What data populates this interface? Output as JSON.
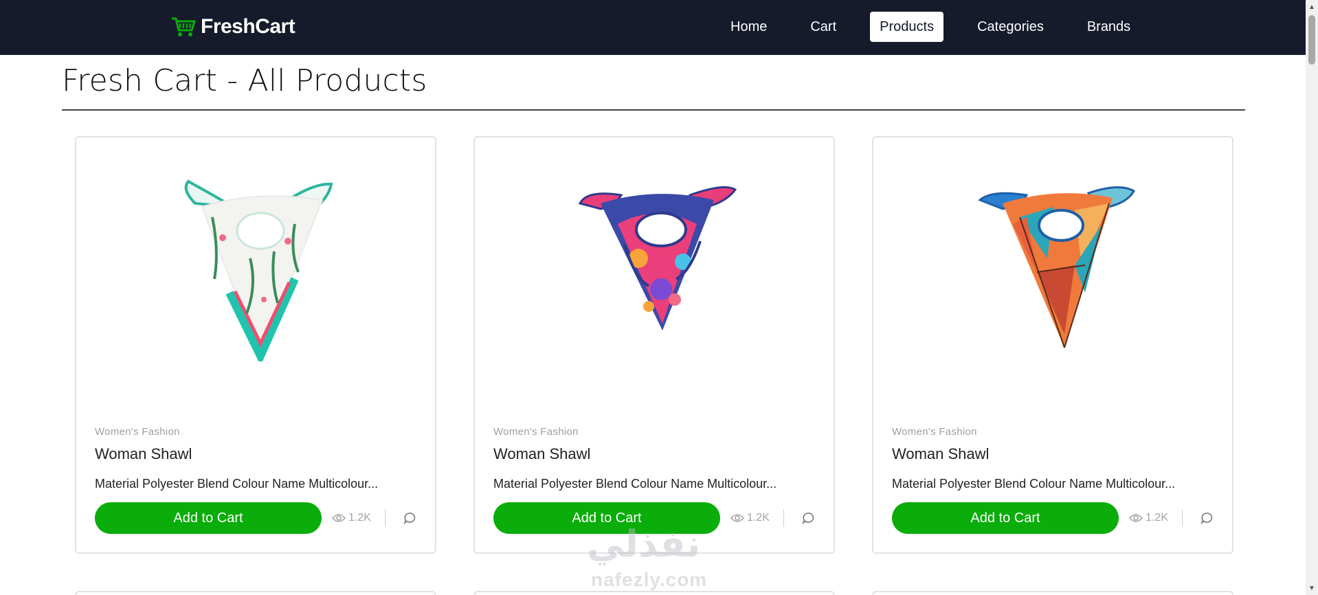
{
  "navbar": {
    "brand": "FreshCart",
    "brand_icon": "shopping-cart-icon",
    "brand_color": "#0aad0a",
    "background": "#151b2b",
    "links": [
      {
        "label": "Home",
        "active": false
      },
      {
        "label": "Cart",
        "active": false
      },
      {
        "label": "Products",
        "active": true
      },
      {
        "label": "Categories",
        "active": false
      },
      {
        "label": "Brands",
        "active": false
      }
    ]
  },
  "page": {
    "title": "Fresh Cart - All Products"
  },
  "products": [
    {
      "category": "Women's Fashion",
      "name": "Woman Shawl",
      "description": "Material Polyester Blend Colour Name Multicolour...",
      "button": "Add to Cart",
      "views": "1.2K",
      "image": "white-floral-scarf-image"
    },
    {
      "category": "Women's Fashion",
      "name": "Woman Shawl",
      "description": "Material Polyester Blend Colour Name Multicolour...",
      "button": "Add to Cart",
      "views": "1.2K",
      "image": "pink-blue-floral-scarf-image"
    },
    {
      "category": "Women's Fashion",
      "name": "Woman Shawl",
      "description": "Material Polyester Blend Colour Name Multicolour...",
      "button": "Add to Cart",
      "views": "1.2K",
      "image": "orange-geometric-scarf-image"
    }
  ],
  "watermark": {
    "arabic": "نفذلي",
    "latin": "nafezly.com"
  },
  "colors": {
    "accent": "#0aad0a",
    "muted": "#9aa0a6"
  }
}
